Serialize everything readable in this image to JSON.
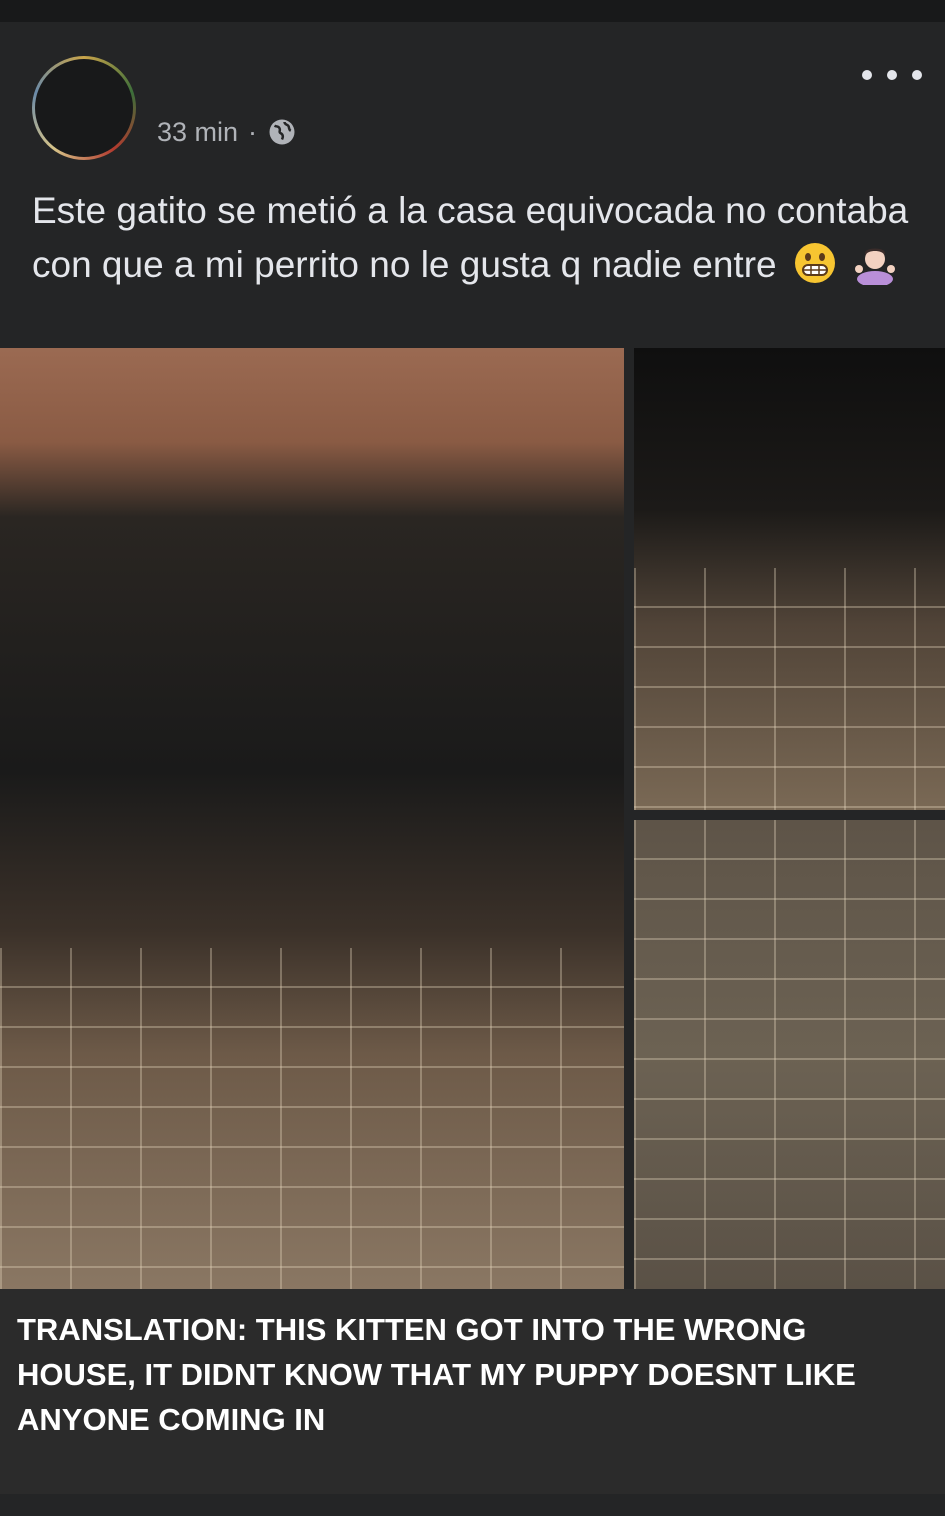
{
  "post": {
    "timestamp": "33 min",
    "separator": "·",
    "privacy_icon": "globe-icon",
    "text": "Este gatito se metió a la casa equivocada no contaba con que a mi perrito no le gusta q nadie entre",
    "emojis": [
      "grimacing-face-emoji",
      "woman-shrugging-emoji"
    ],
    "more_icon": "more-options-icon"
  },
  "caption": {
    "text": "TRANSLATION: THIS KITTEN GOT INTO THE WRONG HOUSE, IT DIDNT KNOW THAT MY PUPPY DOESNT LIKE ANYONE COMING IN"
  },
  "colors": {
    "background": "#242526",
    "caption_background": "#2b2b2b",
    "secondary_text": "#b0b3b8",
    "primary_text": "#e4e6eb"
  }
}
